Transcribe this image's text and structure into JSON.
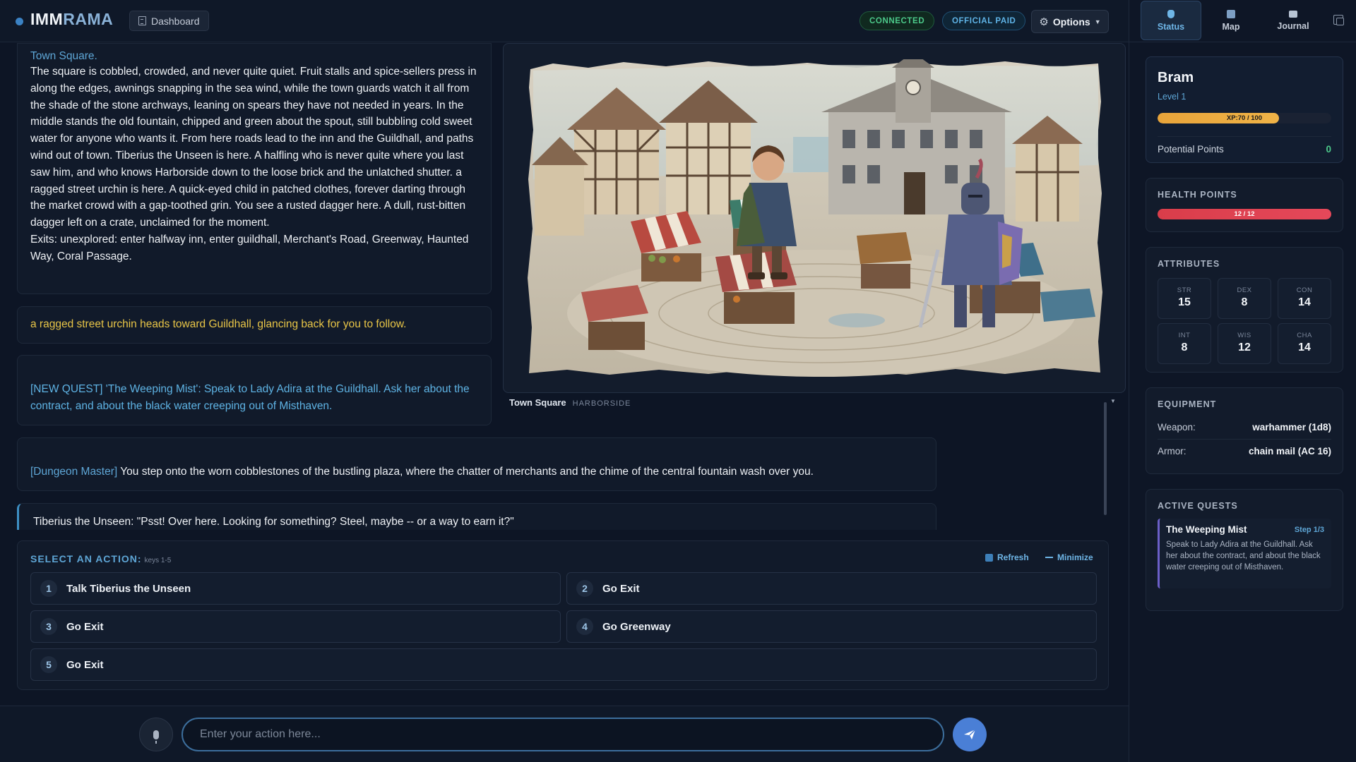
{
  "app": {
    "logo_main": "IMM",
    "logo_accent": "RAMA",
    "dashboard_label": "Dashboard",
    "connected_label": "CONNECTED",
    "paid_label": "OFFICIAL PAID",
    "options_label": "Options"
  },
  "story": {
    "place_title": "Town Square.",
    "main_text": "The square is cobbled, crowded, and never quite quiet. Fruit stalls and spice-sellers press in along the edges, awnings snapping in the sea wind, while the town guards watch it all from the shade of the stone archways, leaning on spears they have not needed in years. In the middle stands the old fountain, chipped and green about the spout, still bubbling cold sweet water for anyone who wants it. From here roads lead to the inn and the Guildhall, and paths wind out of town. Tiberius the Unseen is here. A halfling who is never quite where you last saw him, and who knows Harborside down to the loose brick and the unlatched shutter. a ragged street urchin is here. A quick-eyed child in patched clothes, forever darting through the market crowd with a gap-toothed grin. You see a rusted dagger here. A dull, rust-bitten dagger left on a crate, unclaimed for the moment.",
    "exits": "Exits: unexplored: enter halfway inn, enter guildhall, Merchant's Road, Greenway, Haunted Way, Coral Passage.",
    "follow_msg": "a ragged street urchin heads toward Guildhall, glancing back for you to follow.",
    "quest_msg": "[NEW QUEST] 'The Weeping Mist': Speak to Lady Adira at the Guildhall. Ask her about the contract, and about the black water creeping out of Misthaven.",
    "dm_tag": "[Dungeon Master]",
    "dm_msg": " You step onto the worn cobblestones of the bustling plaza, where the chatter of merchants and the chime of the central fountain wash over you.",
    "npc_msg": "Tiberius the Unseen: \"Psst! Over here. Looking for something? Steel, maybe -- or a way to earn it?\""
  },
  "scene": {
    "location": "Town Square",
    "region": "HARBORSIDE"
  },
  "actions": {
    "title": "SELECT AN ACTION:",
    "keys_hint": "keys 1-5",
    "refresh_label": "Refresh",
    "minimize_label": "Minimize",
    "items": [
      {
        "num": "1",
        "label": "Talk Tiberius the Unseen"
      },
      {
        "num": "2",
        "label": "Go Exit"
      },
      {
        "num": "3",
        "label": "Go Exit"
      },
      {
        "num": "4",
        "label": "Go Greenway"
      },
      {
        "num": "5",
        "label": "Go Exit"
      }
    ]
  },
  "input": {
    "placeholder": "Enter your action here..."
  },
  "sidebar": {
    "tabs": [
      {
        "label": "Status",
        "icon": "shield-icon"
      },
      {
        "label": "Map",
        "icon": "map-icon"
      },
      {
        "label": "Journal",
        "icon": "book-icon"
      }
    ],
    "character": {
      "name": "Bram",
      "level": "Level 1",
      "xp_text": "XP:70 / 100",
      "xp_fraction": 0.7,
      "potential_label": "Potential Points",
      "potential_value": "0"
    },
    "health": {
      "title": "HEALTH POINTS",
      "text": "12 / 12",
      "fraction": 1.0
    },
    "attributes": {
      "title": "ATTRIBUTES",
      "list": [
        {
          "label": "STR",
          "value": "15"
        },
        {
          "label": "DEX",
          "value": "8"
        },
        {
          "label": "CON",
          "value": "14"
        },
        {
          "label": "INT",
          "value": "8"
        },
        {
          "label": "WIS",
          "value": "12"
        },
        {
          "label": "CHA",
          "value": "14"
        }
      ]
    },
    "equipment": {
      "title": "EQUIPMENT",
      "weapon_label": "Weapon:",
      "weapon_value": "warhammer (1d8)",
      "armor_label": "Armor:",
      "armor_value": "chain mail (AC 16)"
    },
    "quests": {
      "title": "ACTIVE QUESTS",
      "items": [
        {
          "title": "The Weeping Mist",
          "step": "Step 1/3",
          "desc": "Speak to Lady Adira at the Guildhall. Ask her about the contract, and about the black water creeping out of Misthaven."
        }
      ]
    }
  },
  "colors": {
    "accent": "#5ea6d6",
    "xp": "#f0b347",
    "hp": "#e5485a",
    "follow": "#e8c547",
    "connected": "#4cc98a"
  }
}
